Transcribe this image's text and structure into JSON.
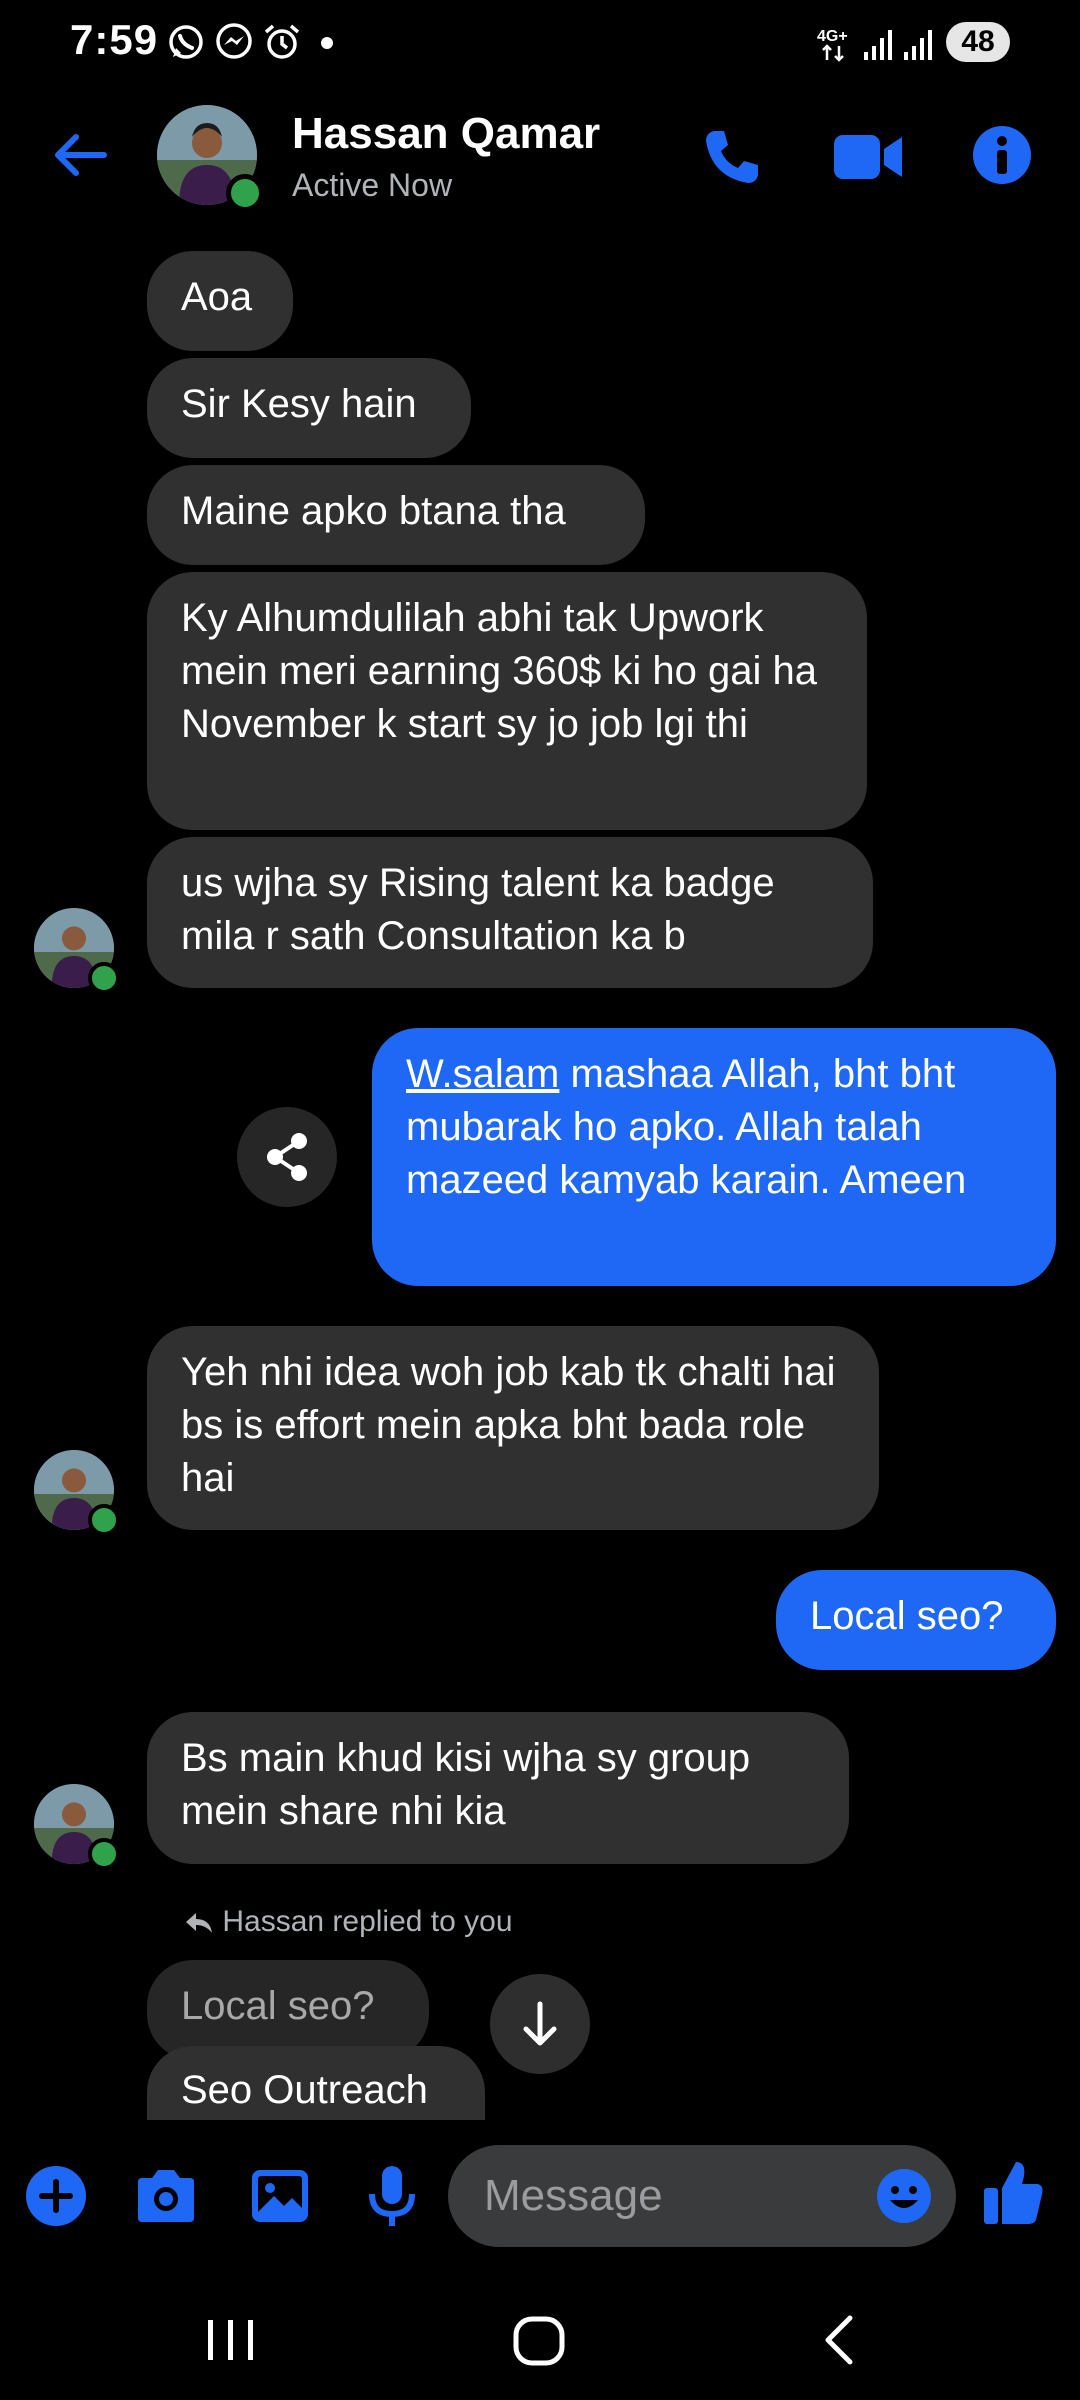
{
  "status_bar": {
    "time": "7:59",
    "battery": "48",
    "network": "4G+"
  },
  "header": {
    "contact_name": "Hassan Qamar",
    "contact_status": "Active Now"
  },
  "messages": [
    {
      "direction": "in",
      "text": "Aoa"
    },
    {
      "direction": "in",
      "text": "Sir Kesy hain"
    },
    {
      "direction": "in",
      "text": "Maine apko btana tha"
    },
    {
      "direction": "in",
      "text": "Ky Alhumdulilah abhi tak Upwork mein meri earning 360$ ki ho gai ha November k start sy jo job lgi thi"
    },
    {
      "direction": "in",
      "text": "us wjha sy Rising talent ka badge mila r sath Consultation ka b"
    },
    {
      "direction": "out",
      "link_text": "W.salam",
      "text": " mashaa Allah, bht bht mubarak ho apko. Allah talah mazeed kamyab karain. Ameen"
    },
    {
      "direction": "in",
      "text": "Yeh nhi idea woh job kab tk chalti hai bs is effort mein apka bht bada role hai"
    },
    {
      "direction": "out",
      "text": "Local seo?"
    },
    {
      "direction": "in",
      "text": "Bs main khud kisi wjha sy group mein share nhi kia"
    }
  ],
  "reply": {
    "label": "Hassan replied to you",
    "quoted_text": "Local seo?",
    "reply_text": "Seo Outreach"
  },
  "composer": {
    "placeholder": "Message"
  },
  "colors": {
    "accent": "#1f68f5",
    "incoming_bubble": "#303030",
    "online": "#31a24c"
  }
}
